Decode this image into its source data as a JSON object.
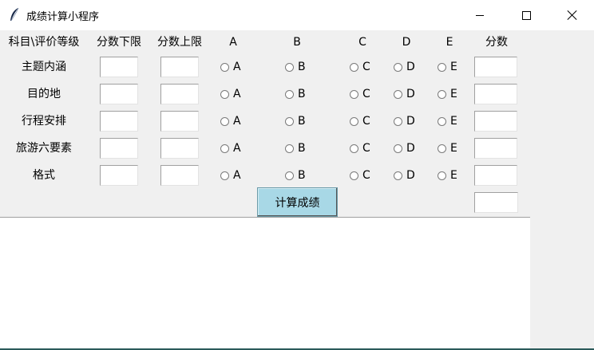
{
  "window": {
    "title": "成绩计算小程序",
    "icon": "feather-icon"
  },
  "headers": {
    "subject": "科目\\评价等级",
    "lower": "分数下限",
    "upper": "分数上限",
    "a": "A",
    "b": "B",
    "c": "C",
    "d": "D",
    "e": "E",
    "score": "分数"
  },
  "rows": [
    {
      "label": "主题内涵",
      "lower": "",
      "upper": "",
      "score": ""
    },
    {
      "label": "目的地",
      "lower": "",
      "upper": "",
      "score": ""
    },
    {
      "label": "行程安排",
      "lower": "",
      "upper": "",
      "score": ""
    },
    {
      "label": "旅游六要素",
      "lower": "",
      "upper": "",
      "score": ""
    },
    {
      "label": "格式",
      "lower": "",
      "upper": "",
      "score": ""
    }
  ],
  "grades": [
    "A",
    "B",
    "C",
    "D",
    "E"
  ],
  "calc_button": "计算成绩",
  "total_score": "",
  "output": ""
}
